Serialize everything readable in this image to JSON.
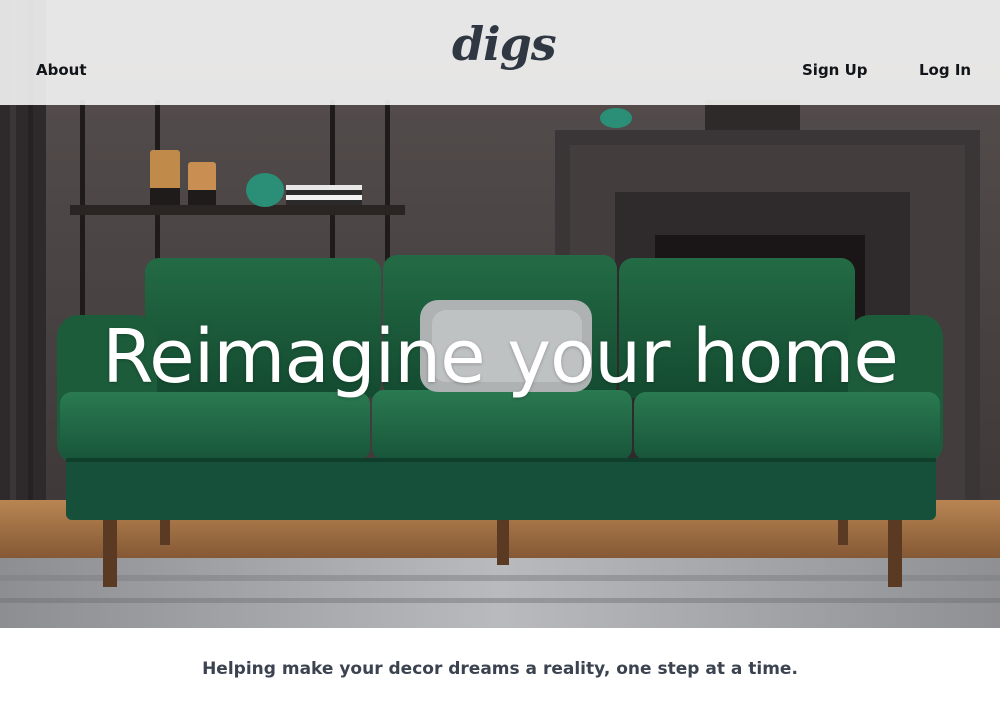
{
  "header": {
    "logo_text": "digs",
    "nav": {
      "about": "About",
      "sign_up": "Sign Up",
      "log_in": "Log In"
    }
  },
  "hero": {
    "headline": "Reimagine your home",
    "image_alt": "green velvet sofa in a dark living room"
  },
  "tagline": "Helping make your decor dreams a reality, one step at a time.",
  "colors": {
    "sofa_green": "#1d5a3c",
    "wall": "#4a4445",
    "text_dark": "#2f3742"
  }
}
